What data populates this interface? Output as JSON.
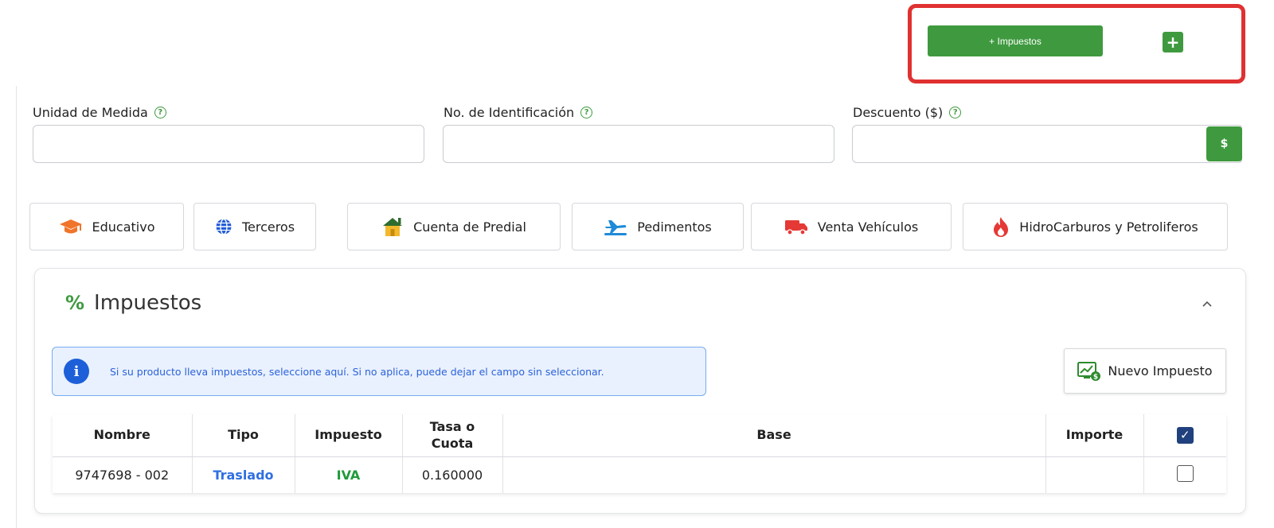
{
  "toolbar": {
    "impuestos_button": "+ Impuestos",
    "plus_button": "+"
  },
  "form": {
    "unidad_label": "Unidad de Medida",
    "identificacion_label": "No. de Identificación",
    "descuento_label": "Descuento ($)",
    "help_glyph": "?",
    "dollar_button": "$",
    "unidad_value": "",
    "identificacion_value": "",
    "descuento_value": ""
  },
  "categories": [
    {
      "label": "Educativo",
      "icon": "graduation-cap-icon",
      "color": "#f0742a"
    },
    {
      "label": "Terceros",
      "icon": "globe-icon",
      "color": "#1f5ad8"
    },
    {
      "label": "Cuenta de Predial",
      "icon": "house-icon",
      "color": "#f2b92c"
    },
    {
      "label": "Pedimentos",
      "icon": "plane-icon",
      "color": "#1f8ad8"
    },
    {
      "label": "Venta Vehículos",
      "icon": "truck-icon",
      "color": "#e53935"
    },
    {
      "label": "HidroCarburos y Petroliferos",
      "icon": "fire-icon",
      "color": "#e53935"
    }
  ],
  "impuestos": {
    "title": "Impuestos",
    "alert_text": "Si su producto lleva impuestos, seleccione aquí. Si no aplica, puede dejar el campo sin seleccionar.",
    "new_button": "Nuevo Impuesto",
    "columns": [
      "Nombre",
      "Tipo",
      "Impuesto",
      "Tasa o Cuota",
      "Base",
      "Importe"
    ],
    "rows": [
      {
        "nombre": "9747698 - 002",
        "tipo": "Traslado",
        "impuesto": "IVA",
        "tasa": "0.160000",
        "base": "",
        "importe": "",
        "checked": false
      }
    ],
    "header_checked": true
  },
  "colors": {
    "primary_green": "#3f9a3f",
    "highlight_red": "#e03131",
    "info_blue": "#1d5fd8",
    "link_blue": "#2f6fe0",
    "tax_green": "#1f9a3b"
  }
}
